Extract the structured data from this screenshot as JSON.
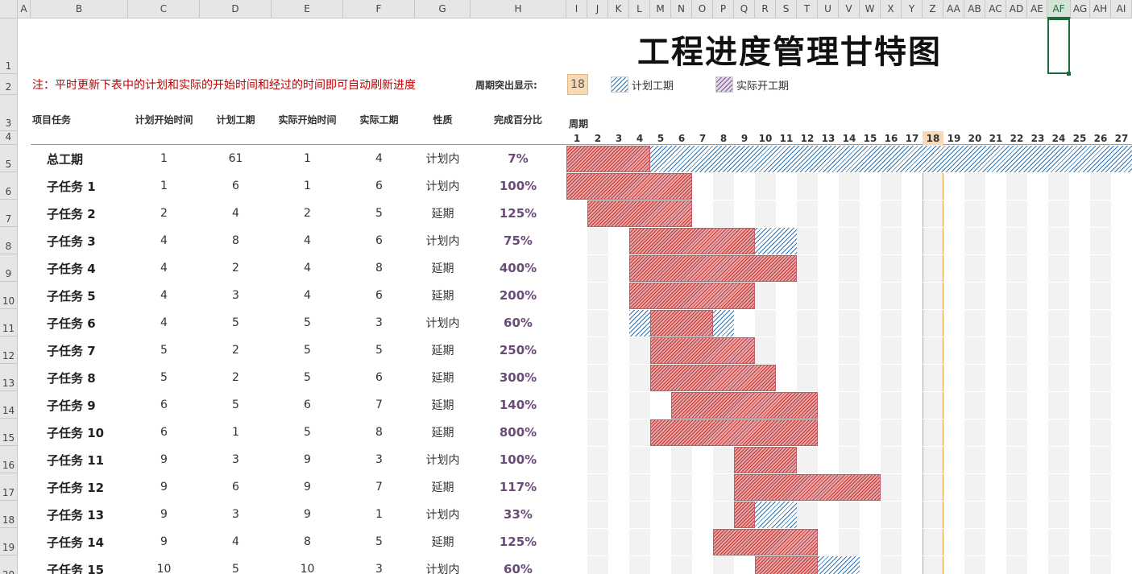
{
  "column_letters": [
    "A",
    "B",
    "C",
    "D",
    "E",
    "F",
    "G",
    "H",
    "I",
    "J",
    "K",
    "L",
    "M",
    "N",
    "O",
    "P",
    "Q",
    "R",
    "S",
    "T",
    "U",
    "V",
    "W",
    "X",
    "Y",
    "Z",
    "AA",
    "AB",
    "AC",
    "AD",
    "AE",
    "AF",
    "AG",
    "AH",
    "AI"
  ],
  "row_numbers": [
    "1",
    "2",
    "3",
    "4",
    "5",
    "6",
    "7",
    "8",
    "9",
    "10",
    "11",
    "12",
    "13",
    "14",
    "15",
    "16",
    "17",
    "18",
    "19",
    "20"
  ],
  "selected_column": "AF",
  "title": "工程进度管理甘特图",
  "note": "注：平时更新下表中的计划和实际的开始时间和经过的时间即可自动刷新进度",
  "highlight_label": "周期突出显示:",
  "highlight_value": "18",
  "legend": {
    "plan": "计划工期",
    "actual": "实际开工期"
  },
  "headers": {
    "task": "项目任务",
    "plan_start": "计划开始时间",
    "plan_duration": "计划工期",
    "actual_start": "实际开始时间",
    "actual_duration": "实际工期",
    "nature": "性质",
    "percent": "完成百分比",
    "period": "周期"
  },
  "days": [
    "1",
    "2",
    "3",
    "4",
    "5",
    "6",
    "7",
    "8",
    "9",
    "10",
    "11",
    "12",
    "13",
    "14",
    "15",
    "16",
    "17",
    "18",
    "19",
    "20",
    "21",
    "22",
    "23",
    "24",
    "25",
    "26",
    "27"
  ],
  "tasks": [
    {
      "name": "总工期",
      "plan_start": 1,
      "plan_duration": 61,
      "actual_start": 1,
      "actual_duration": 4,
      "nature": "计划内",
      "percent": "7%"
    },
    {
      "name": "子任务 1",
      "plan_start": 1,
      "plan_duration": 6,
      "actual_start": 1,
      "actual_duration": 6,
      "nature": "计划内",
      "percent": "100%"
    },
    {
      "name": "子任务 2",
      "plan_start": 2,
      "plan_duration": 4,
      "actual_start": 2,
      "actual_duration": 5,
      "nature": "延期",
      "percent": "125%"
    },
    {
      "name": "子任务 3",
      "plan_start": 4,
      "plan_duration": 8,
      "actual_start": 4,
      "actual_duration": 6,
      "nature": "计划内",
      "percent": "75%"
    },
    {
      "name": "子任务 4",
      "plan_start": 4,
      "plan_duration": 2,
      "actual_start": 4,
      "actual_duration": 8,
      "nature": "延期",
      "percent": "400%"
    },
    {
      "name": "子任务 5",
      "plan_start": 4,
      "plan_duration": 3,
      "actual_start": 4,
      "actual_duration": 6,
      "nature": "延期",
      "percent": "200%"
    },
    {
      "name": "子任务 6",
      "plan_start": 4,
      "plan_duration": 5,
      "actual_start": 5,
      "actual_duration": 3,
      "nature": "计划内",
      "percent": "60%"
    },
    {
      "name": "子任务 7",
      "plan_start": 5,
      "plan_duration": 2,
      "actual_start": 5,
      "actual_duration": 5,
      "nature": "延期",
      "percent": "250%"
    },
    {
      "name": "子任务 8",
      "plan_start": 5,
      "plan_duration": 2,
      "actual_start": 5,
      "actual_duration": 6,
      "nature": "延期",
      "percent": "300%"
    },
    {
      "name": "子任务 9",
      "plan_start": 6,
      "plan_duration": 5,
      "actual_start": 6,
      "actual_duration": 7,
      "nature": "延期",
      "percent": "140%"
    },
    {
      "name": "子任务 10",
      "plan_start": 6,
      "plan_duration": 1,
      "actual_start": 5,
      "actual_duration": 8,
      "nature": "延期",
      "percent": "800%"
    },
    {
      "name": "子任务 11",
      "plan_start": 9,
      "plan_duration": 3,
      "actual_start": 9,
      "actual_duration": 3,
      "nature": "计划内",
      "percent": "100%"
    },
    {
      "name": "子任务 12",
      "plan_start": 9,
      "plan_duration": 6,
      "actual_start": 9,
      "actual_duration": 7,
      "nature": "延期",
      "percent": "117%"
    },
    {
      "name": "子任务 13",
      "plan_start": 9,
      "plan_duration": 3,
      "actual_start": 9,
      "actual_duration": 1,
      "nature": "计划内",
      "percent": "33%"
    },
    {
      "name": "子任务 14",
      "plan_start": 9,
      "plan_duration": 4,
      "actual_start": 8,
      "actual_duration": 5,
      "nature": "延期",
      "percent": "125%"
    },
    {
      "name": "子任务 15",
      "plan_start": 10,
      "plan_duration": 5,
      "actual_start": 10,
      "actual_duration": 3,
      "nature": "计划内",
      "percent": "60%"
    }
  ]
}
